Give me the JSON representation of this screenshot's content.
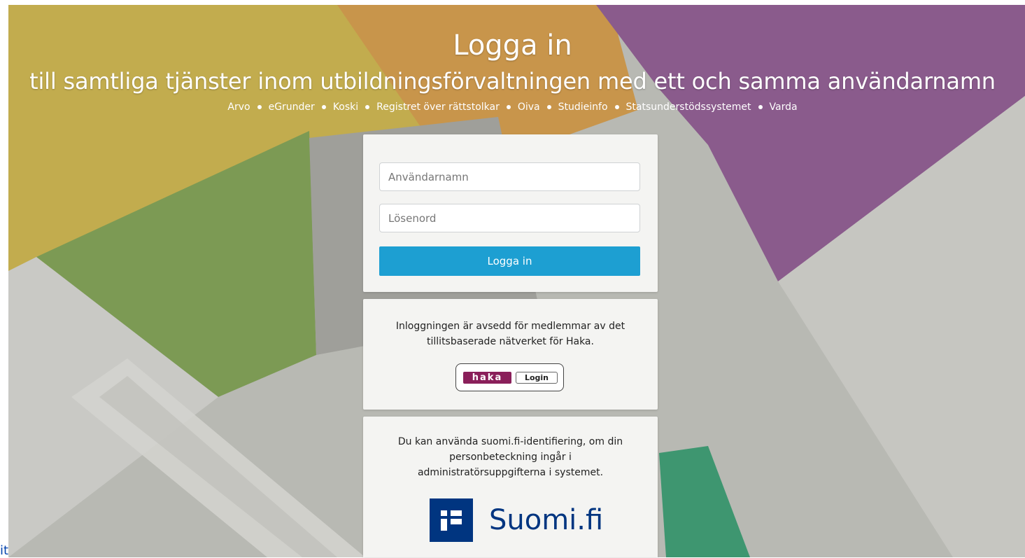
{
  "header": {
    "title": "Logga in",
    "subtitle": "till samtliga tjänster inom utbildningsförvaltningen med ett och samma användarnamn",
    "services": [
      "Arvo",
      "eGrunder",
      "Koski",
      "Registret över rättstolkar",
      "Oiva",
      "Studieinfo",
      "Statsunderstödssystemet",
      "Varda"
    ]
  },
  "login": {
    "username_placeholder": "Användarnamn",
    "password_placeholder": "Lösenord",
    "button_label": "Logga in"
  },
  "haka": {
    "info": "Inloggningen är avsedd för medlemmar av det tillitsbaserade nätverket för Haka.",
    "logo_text": "haka",
    "login_label": "Login"
  },
  "suomi": {
    "info": "Du kan använda suomi.fi-identifiering, om din personbeteckning ingår i administratörsuppgifterna i systemet.",
    "logo_text": "Suomi.fi"
  },
  "corner_link": "it",
  "colors": {
    "primary_button": "#1d9fd2",
    "haka_brand": "#8a1f5a",
    "suomi_brand": "#003580"
  }
}
